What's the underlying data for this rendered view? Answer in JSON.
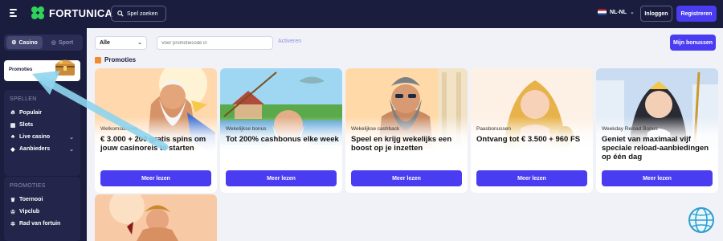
{
  "header": {
    "brand": "FORTUNICA",
    "search_label": "Spel zoeken",
    "language": "NL-NL",
    "login_label": "Inloggen",
    "register_label": "Registreren"
  },
  "sidebar": {
    "casino_label": "Casino",
    "sport_label": "Sport",
    "promo_label": "Promoties",
    "games_title": "SPELLEN",
    "games": [
      {
        "label": "Populair",
        "icon": "flame-icon"
      },
      {
        "label": "Slots",
        "icon": "slot-machine-icon"
      },
      {
        "label": "Live casino",
        "icon": "live-casino-icon"
      },
      {
        "label": "Aanbieders",
        "icon": "providers-icon"
      }
    ],
    "promos_title": "PROMOTIES",
    "promos": [
      {
        "label": "Toernooi",
        "icon": "trophy-icon"
      },
      {
        "label": "Vipclub",
        "icon": "crown-icon"
      },
      {
        "label": "Rad van fortuin",
        "icon": "wheel-icon"
      }
    ]
  },
  "filters": {
    "select_value": "Alle",
    "promo_placeholder": "Voer promotiecode in",
    "activate_label": "Activeren",
    "my_bonuses_label": "Mijn bonussen"
  },
  "section_title": "Promoties",
  "cards": [
    {
      "kicker": "Welkomstbonus",
      "headline": "€ 3.000 + 200 gratis spins om jouw casinoreis te starten",
      "cta": "Meer lezen"
    },
    {
      "kicker": "Wekelijkse bonus",
      "headline": "Tot 200% cashbonus elke week",
      "cta": "Meer lezen"
    },
    {
      "kicker": "Wekelijkse cashback",
      "headline": "Speel en krijg wekelijks een boost op je inzetten",
      "cta": "Meer lezen"
    },
    {
      "kicker": "Paasbonussen",
      "headline": "Ontvang tot € 3.500 + 960 FS",
      "cta": "Meer lezen"
    },
    {
      "kicker": "Weekday Reload Bonus",
      "headline": "Geniet van maximaal vijf speciale reload-aanbiedingen op één dag",
      "cta": "Meer lezen"
    }
  ],
  "colors": {
    "accent": "#4a3cf0",
    "sidebar": "#1b1d3f",
    "brand_green": "#2fd35a"
  }
}
